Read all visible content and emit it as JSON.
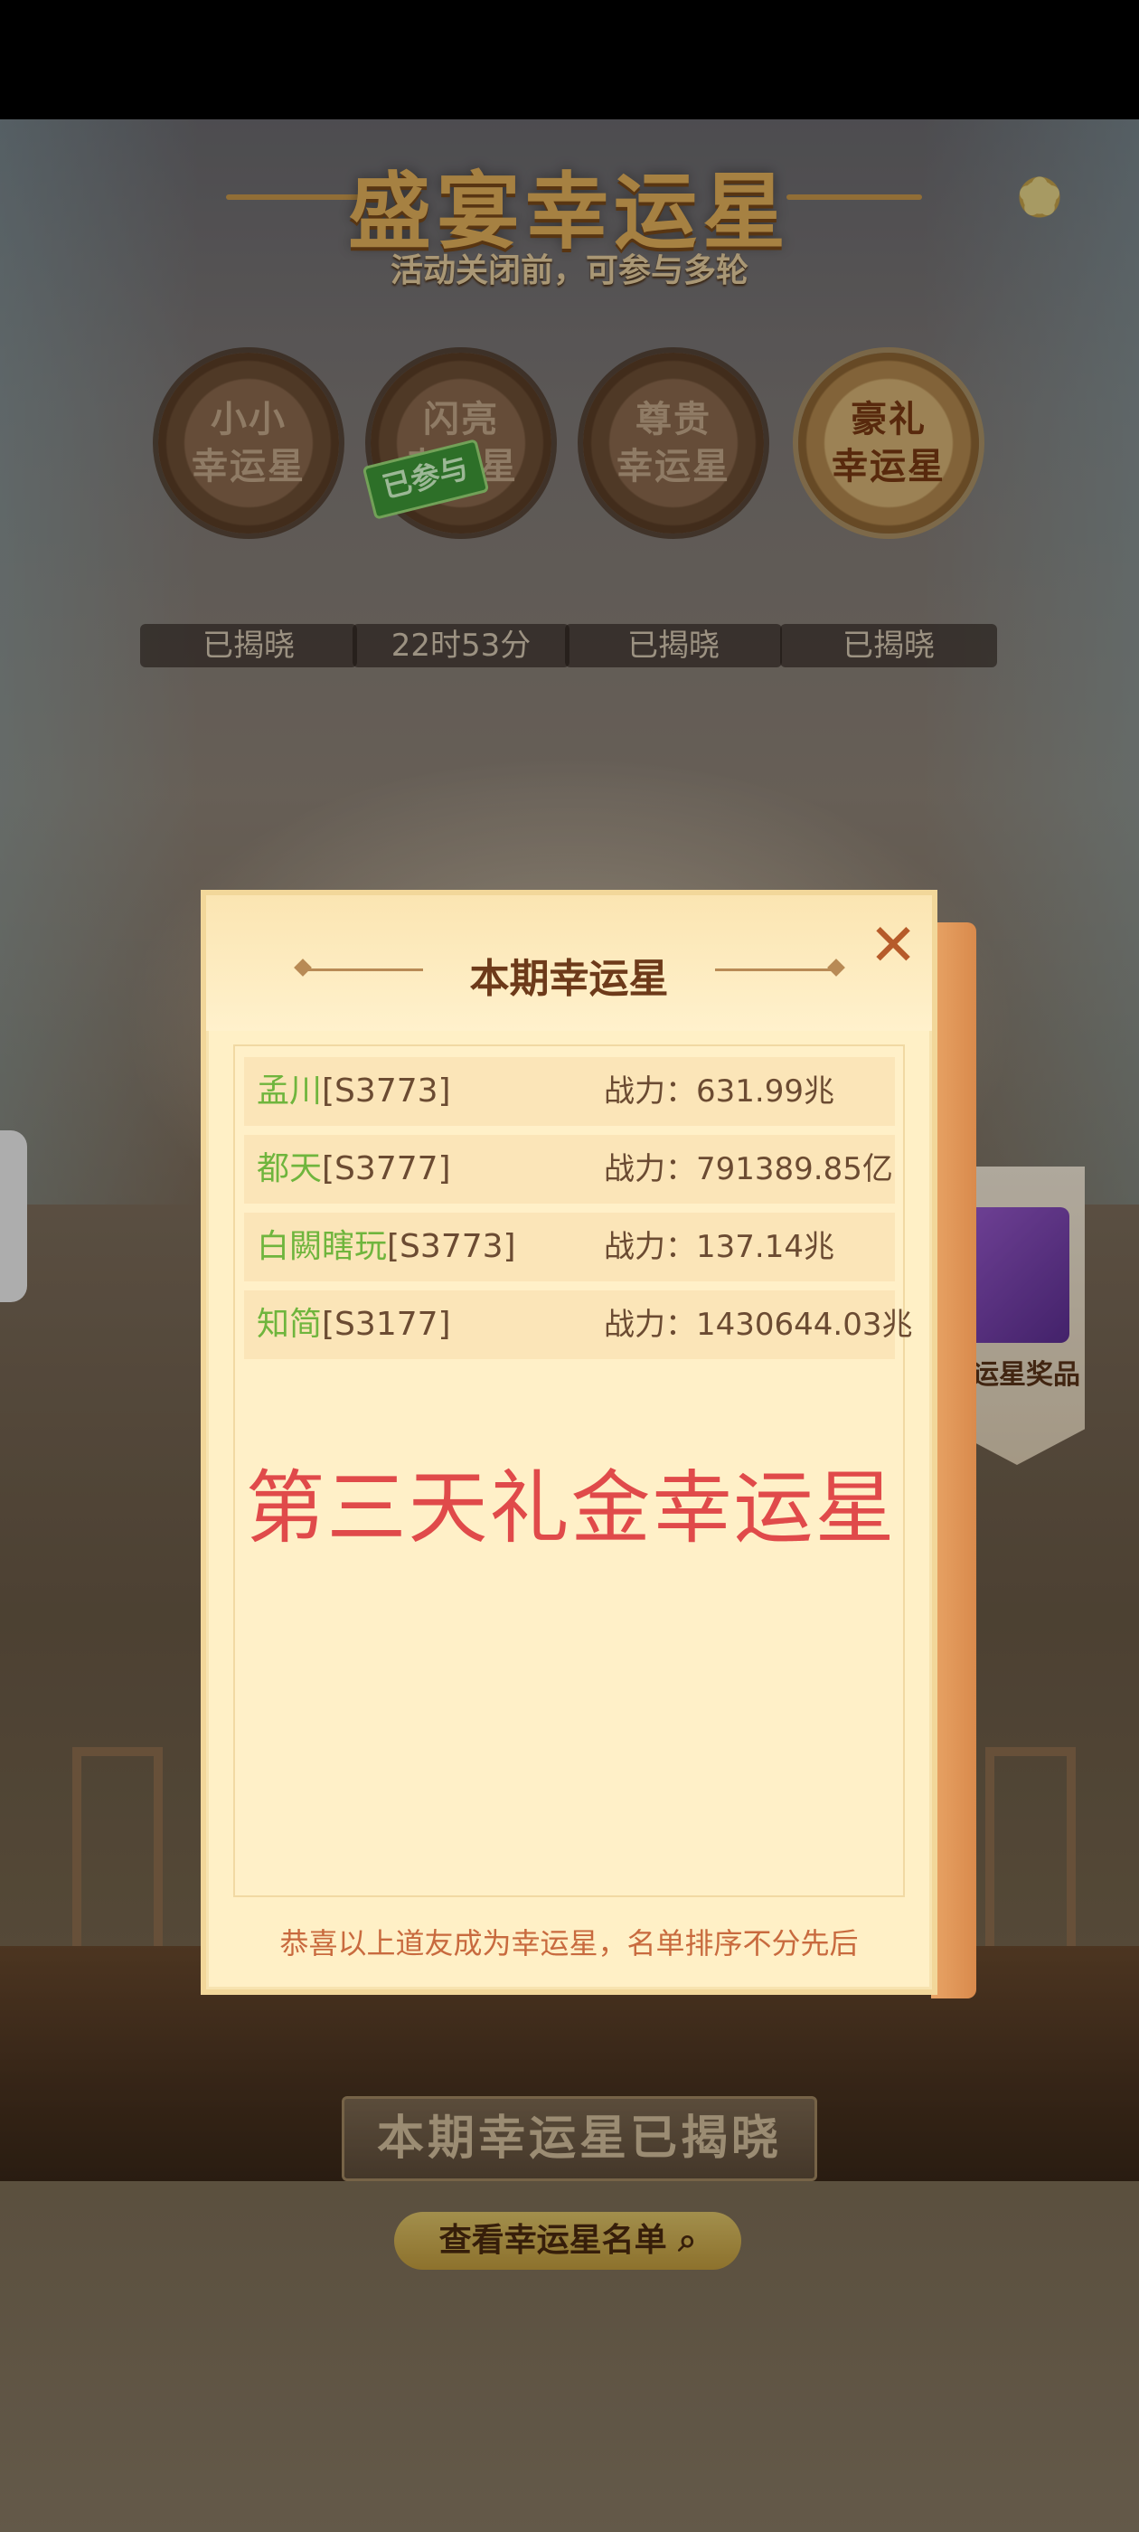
{
  "header": {
    "title": "盛宴幸运星",
    "subtitle": "活动关闭前，可参与多轮"
  },
  "tiers": [
    {
      "label_line1": "小小",
      "label_line2": "幸运星",
      "status": "已揭晓"
    },
    {
      "label_line1": "闪亮",
      "label_line2": "幸运星",
      "status": "22时53分",
      "tag": "已参与"
    },
    {
      "label_line1": "尊贵",
      "label_line2": "幸运星",
      "status": "已揭晓"
    },
    {
      "label_line1": "豪礼",
      "label_line2": "幸运星",
      "status": "已揭晓"
    }
  ],
  "side_prize": {
    "label": "运星奖品"
  },
  "modal": {
    "title": "本期幸运星",
    "winners": [
      {
        "name": "孟川",
        "server": "[S3773]",
        "power": "战力：631.99兆"
      },
      {
        "name": "都天",
        "server": "[S3777]",
        "power": "战力：791389.85亿"
      },
      {
        "name": "白闕瞎玩",
        "server": "[S3773]",
        "power": "战力：137.14兆"
      },
      {
        "name": "知简",
        "server": "[S3177]",
        "power": "战力：1430644.03兆"
      }
    ],
    "overlay_caption": "第三天礼金幸运星",
    "footer_note": "恭喜以上道友成为幸运星，名单排序不分先后"
  },
  "bottom": {
    "revealed_label": "本期幸运星已揭晓",
    "view_list_label": "查看幸运星名单"
  },
  "colors": {
    "accent_gold": "#e7b35c",
    "winner_name_green": "#6fb53d",
    "caption_red": "#e04a4a",
    "modal_bg": "#fff0c6"
  }
}
